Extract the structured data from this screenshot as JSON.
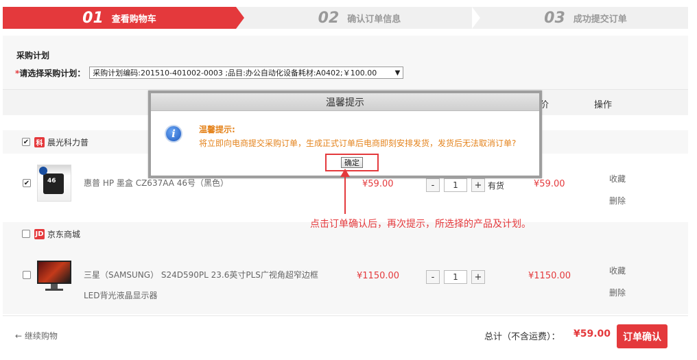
{
  "steps": [
    {
      "num": "01",
      "label": "查看购物车"
    },
    {
      "num": "02",
      "label": "确认订单信息"
    },
    {
      "num": "03",
      "label": "成功提交订单"
    }
  ],
  "plan": {
    "title": "采购计划",
    "required_mark": "*",
    "label": "请选择采购计划：",
    "selected": "采购计划编码:201510-401002-0003 ;品目:办公自动化设备耗材:A0402;￥100.00"
  },
  "table_head": {
    "price": "价",
    "op": "操作"
  },
  "shops": [
    {
      "name": "晨光科力普",
      "logo": "科",
      "checked": true,
      "items": [
        {
          "name": "惠普 HP 墨盒 CZ637AA 46号（黑色）",
          "price": "¥59.00",
          "qty": "1",
          "stock": "有货",
          "subtotal": "¥59.00",
          "checked": true,
          "fav": "收藏",
          "del": "删除"
        }
      ]
    },
    {
      "name": "京东商城",
      "logo": "JD",
      "checked": false,
      "items": [
        {
          "name": "三星（SAMSUNG） S24D590PL 23.6英寸PLS广视角超窄边框LED背光液晶显示器",
          "price": "¥1150.00",
          "qty": "1",
          "subtotal": "¥1150.00",
          "checked": false,
          "fav": "收藏",
          "del": "删除"
        }
      ]
    }
  ],
  "qty_minus": "-",
  "qty_plus": "+",
  "footer": {
    "continue": "← 继续购物",
    "total_label": "总计（不含运费）：",
    "total_value": "¥59.00",
    "confirm": "订单确认"
  },
  "dialog": {
    "title": "温馨提示",
    "tip_title": "温馨提示:",
    "message": "将立即向电商提交采购订单，生成正式订单后电商即刻安排发货，发货后无法取消订单?",
    "ok": "确定"
  },
  "annotation": "点击订单确认后，再次提示，所选择的产品及计划。",
  "colors": {
    "accent": "#e4393c",
    "tip": "#e4831c"
  }
}
